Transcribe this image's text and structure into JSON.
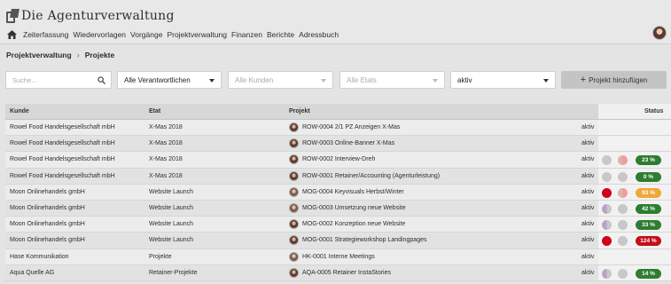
{
  "app": {
    "title": "Die  Agenturverwaltung"
  },
  "nav": [
    "Zeiterfassung",
    "Wiedervorlagen",
    "Vorgänge",
    "Projektverwaltung",
    "Finanzen",
    "Berichte",
    "Adressbuch"
  ],
  "breadcrumb": {
    "parent": "Projektverwaltung",
    "current": "Projekte"
  },
  "filters": {
    "search_placeholder": "Suche...",
    "verantwortliche": "Alle Verantwortlichen",
    "kunden": "Alle Kunden",
    "etats": "Alle Etats",
    "status": "aktiv"
  },
  "add_button": "Projekt hinzufügen",
  "table": {
    "headers": {
      "kunde": "Kunde",
      "etat": "Etat",
      "projekt": "Projekt",
      "status": "Status"
    },
    "rows": [
      {
        "kunde": "Rowel Food Handelsgesellschaft mbH",
        "etat": "X-Mas 2018",
        "projekt": "ROW-0004 2/1 PZ Anzeigen X-Mas",
        "state": "aktiv",
        "badge": ""
      },
      {
        "kunde": "Rowel Food Handelsgesellschaft mbH",
        "etat": "X-Mas 2018",
        "projekt": "ROW-0003 Online-Banner X-Mas",
        "state": "aktiv",
        "badge": ""
      },
      {
        "kunde": "Rowel Food Handelsgesellschaft mbH",
        "etat": "X-Mas 2018",
        "projekt": "ROW-0002 Interview-Dreh",
        "state": "aktiv",
        "badge": "23 %"
      },
      {
        "kunde": "Rowel Food Handelsgesellschaft mbH",
        "etat": "X-Mas 2018",
        "projekt": "ROW-0001 Retainer/Accounting (Agenturleistung)",
        "state": "aktiv",
        "badge": "0 %"
      },
      {
        "kunde": "Moon Onlinehandels gmbH",
        "etat": "Website Launch",
        "projekt": "MOG-0004 Keyvisuals Herbst/Winter",
        "state": "aktiv",
        "badge": "93 %"
      },
      {
        "kunde": "Moon Onlinehandels gmbH",
        "etat": "Website Launch",
        "projekt": "MOG-0003 Umsetzung neue Website",
        "state": "aktiv",
        "badge": "42 %"
      },
      {
        "kunde": "Moon Onlinehandels gmbH",
        "etat": "Website Launch",
        "projekt": "MOG-0002 Konzeption neue Website",
        "state": "aktiv",
        "badge": "33 %"
      },
      {
        "kunde": "Moon Onlinehandels gmbH",
        "etat": "Website Launch",
        "projekt": "MOG-0001 Strategieworkshop Landingpages",
        "state": "aktiv",
        "badge": "124 %"
      },
      {
        "kunde": "Hase Kommunikation",
        "etat": "Projekte",
        "projekt": "HK-0001 Interne Meetings",
        "state": "aktiv",
        "badge": ""
      },
      {
        "kunde": "Aqua Quelle AG",
        "etat": "Retainer-Projekte",
        "projekt": "AQA-0005 Retainer InstaStories",
        "state": "aktiv",
        "badge": "14 %"
      }
    ]
  },
  "colors": {
    "green": "#2e7d32",
    "orange": "#f0a83a",
    "red": "#c0101a"
  }
}
